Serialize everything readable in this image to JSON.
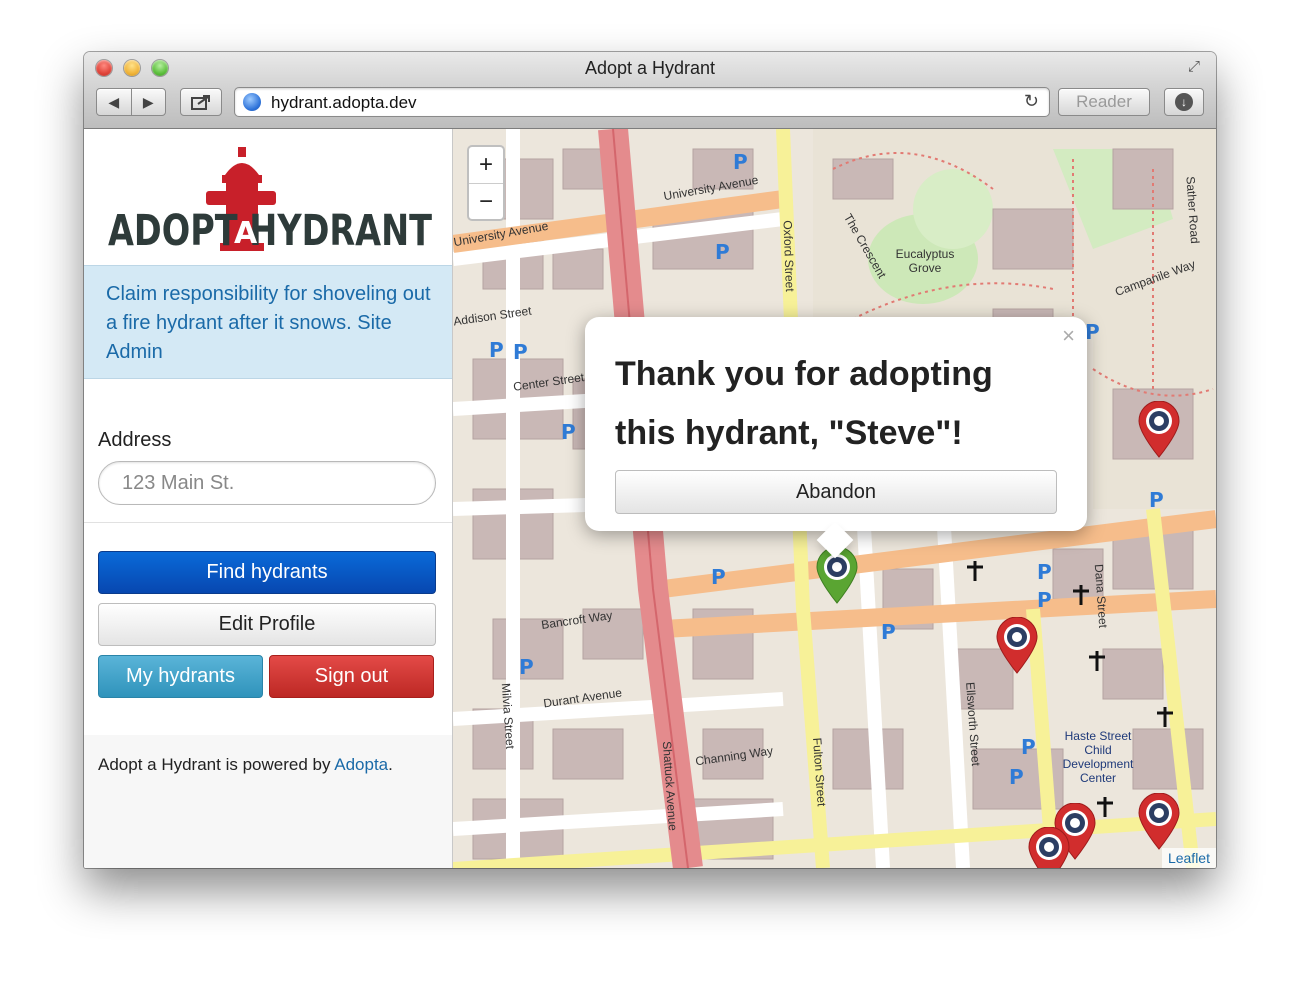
{
  "browser": {
    "window_title": "Adopt a Hydrant",
    "url": "hydrant.adopta.dev",
    "reader_label": "Reader",
    "back_glyph": "◀",
    "forward_glyph": "▶"
  },
  "sidebar": {
    "logo_text": "ADOPTAHYDRANT",
    "intro_text": "Claim responsibility for shoveling out a fire hydrant after it snows.",
    "admin_link": "Site Admin",
    "address_label": "Address",
    "address_placeholder": "123 Main St.",
    "buttons": {
      "find": "Find hydrants",
      "edit_profile": "Edit Profile",
      "my_hydrants": "My hydrants",
      "sign_out": "Sign out"
    },
    "footer_prefix": "Adopt a Hydrant is powered by ",
    "footer_link": "Adopta",
    "footer_suffix": "."
  },
  "map": {
    "zoom_in": "+",
    "zoom_out": "−",
    "attribution": "Leaflet",
    "popup": {
      "message": "Thank you for adopting this hydrant, \"Steve\"!",
      "close": "×",
      "abandon_label": "Abandon"
    },
    "streets": {
      "university_avenue": "University Avenue",
      "oxford_street": "Oxford Street",
      "addison_street": "Addison Street",
      "center_street": "Center Street",
      "bancroft_way": "Bancroft Way",
      "durant_avenue": "Durant Avenue",
      "channing_way": "Channing Way",
      "shattuck_avenue": "Shattuck Avenue",
      "fulton_street": "Fulton Street",
      "ellsworth_street": "Ellsworth Street",
      "dana_street": "Dana Street",
      "milvia_street": "Milvia Street",
      "the_crescent": "The Crescent",
      "eucalyptus_grove": "Eucalyptus Grove",
      "campanile_way": "Campanile Way",
      "sather_road": "Sather Road",
      "haste_center": "Haste Street Child Development Center"
    },
    "markers": [
      {
        "status": "adopted",
        "color": "#5aa532"
      },
      {
        "status": "available",
        "color": "#d12d2d"
      },
      {
        "status": "available",
        "color": "#d12d2d"
      },
      {
        "status": "available",
        "color": "#d12d2d"
      },
      {
        "status": "available",
        "color": "#d12d2d"
      },
      {
        "status": "available",
        "color": "#d12d2d"
      }
    ]
  }
}
